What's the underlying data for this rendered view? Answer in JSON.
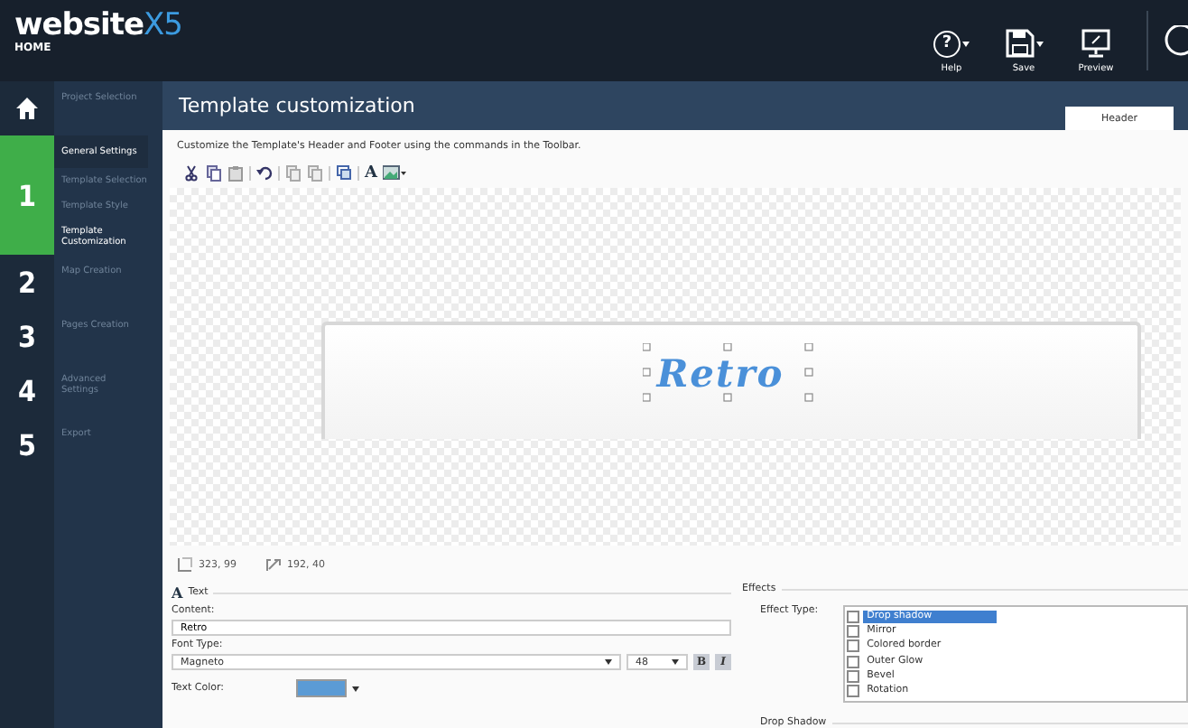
{
  "app": {
    "logo": "website",
    "logo_suffix": "X5",
    "edition": "HOME"
  },
  "toolbar": [
    {
      "kind": "help",
      "glyph": "?",
      "label": "Help",
      "dropdown": true
    },
    {
      "kind": "save",
      "label": "Save",
      "dropdown": true
    },
    {
      "kind": "preview",
      "label": "Preview",
      "dropdown": false
    }
  ],
  "sidebar": [
    {
      "kind": "home",
      "label": "Project Selection",
      "selected": false
    },
    {
      "kind": "step",
      "number": "1",
      "label": "General Settings",
      "selected": true,
      "children": [
        {
          "label": "Template Selection",
          "selected": false
        },
        {
          "label": "Template Style",
          "selected": false
        },
        {
          "label": "Template Customization",
          "selected": true
        }
      ]
    },
    {
      "kind": "step",
      "number": "2",
      "label": "Map Creation",
      "selected": false
    },
    {
      "kind": "step",
      "number": "3",
      "label": "Pages Creation",
      "selected": false
    },
    {
      "kind": "step",
      "number": "4",
      "label": "Advanced Settings",
      "selected": false
    },
    {
      "kind": "step",
      "number": "5",
      "label": "Export",
      "selected": false
    }
  ],
  "main": {
    "title": "Template customization",
    "tabs": [
      {
        "label": "Header",
        "selected": true
      }
    ],
    "description": "Customize the Template's Header and Footer using the commands in the Toolbar.",
    "text_tool_glyph": "A",
    "canvas": {
      "text": "Retro",
      "size": "323, 99",
      "position": "192, 40"
    },
    "text_section": {
      "heading_glyph": "A",
      "heading": "Text",
      "content_label": "Content:",
      "content": "Retro",
      "font_label": "Font Type:",
      "font": "Magneto",
      "size": "48",
      "bold_label": "B",
      "bold": true,
      "italic_label": "I",
      "italic": true,
      "color_label": "Text Color:"
    },
    "effects": {
      "heading": "Effects",
      "type_label": "Effect Type:",
      "items": [
        {
          "label": "Drop shadow",
          "checked": false,
          "selected": true
        },
        {
          "label": "Mirror",
          "checked": false,
          "selected": false
        },
        {
          "label": "Colored border",
          "checked": false,
          "selected": false
        },
        {
          "label": "Outer Glow",
          "checked": false,
          "selected": false
        },
        {
          "label": "Bevel",
          "checked": false,
          "selected": false
        },
        {
          "label": "Rotation",
          "checked": false,
          "selected": false
        }
      ],
      "sub_heading": "Drop Shadow"
    }
  }
}
